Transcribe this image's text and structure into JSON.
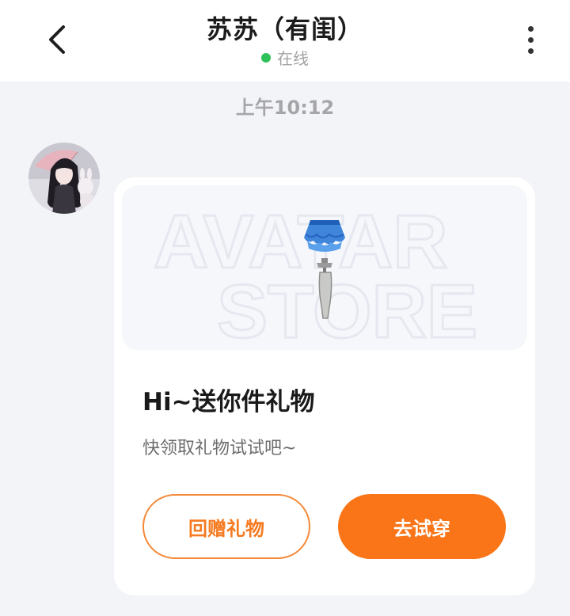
{
  "header": {
    "title": "苏苏（有闺）",
    "status": "在线",
    "status_color": "#2ec15a"
  },
  "chat": {
    "timestamp": "上午10:12"
  },
  "gift_card": {
    "banner_watermark_line1": "AVATAR",
    "banner_watermark_line2": "STORE",
    "item_icon": "blue-ruffle-skirt-with-hanger",
    "title": "Hi~送你件礼物",
    "subtitle": "快领取礼物试试吧~",
    "return_gift_label": "回赠礼物",
    "try_on_label": "去试穿",
    "accent_color": "#f97518"
  }
}
